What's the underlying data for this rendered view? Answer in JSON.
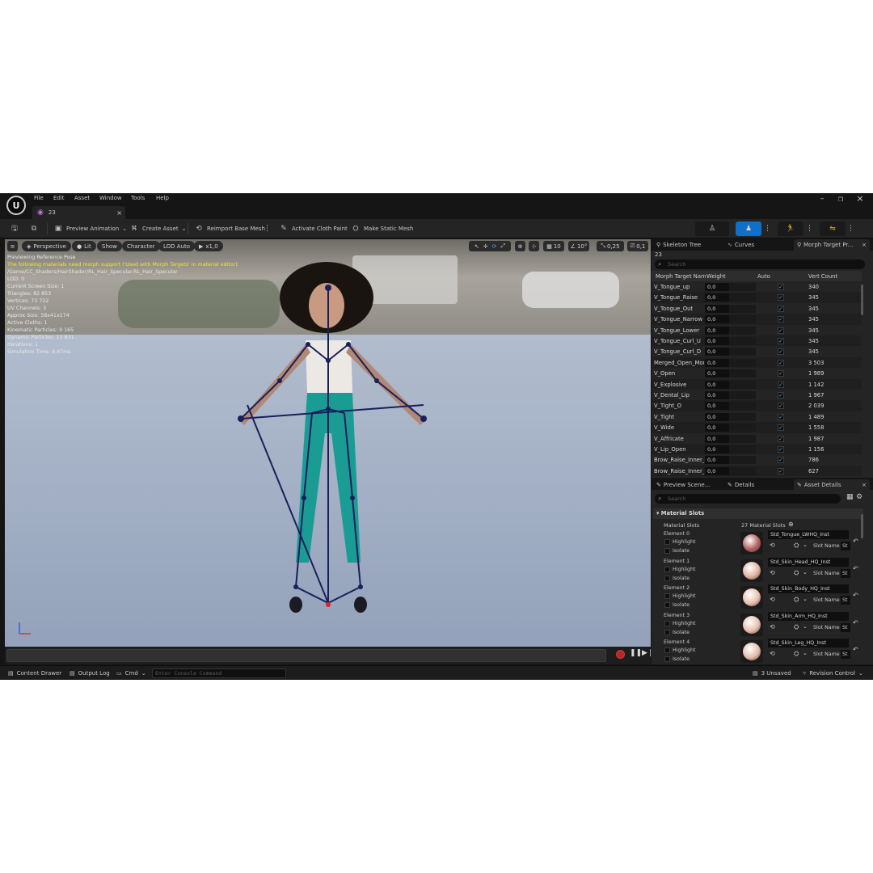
{
  "menu": [
    "File",
    "Edit",
    "Asset",
    "Window",
    "Tools",
    "Help"
  ],
  "asset_tab": "23",
  "toolbar": {
    "preview_animation": "Preview Animation",
    "create_asset": "Create Asset",
    "reimport": "Reimport Base Mesh",
    "activate_cloth": "Activate Cloth Paint",
    "make_static": "Make Static Mesh"
  },
  "viewport": {
    "perspective": "Perspective",
    "lit": "Lit",
    "show": "Show",
    "character": "Character",
    "lod": "LOD Auto",
    "speed": "x1,0",
    "grid_snap": "10",
    "rot_snap": "10°",
    "scale_snap": "0,25",
    "cam_speed": "0,1",
    "stats": [
      {
        "text": "Previewing Reference Pose",
        "warn": false
      },
      {
        "text": "The following materials need morph support ('Used with Morph Targets' in material editor):",
        "warn": true
      },
      {
        "text": "/Game/CC_Shaders/HairShader/RL_Hair_Specular.RL_Hair_Specular",
        "warn": false
      },
      {
        "text": "LOD: 0",
        "warn": false
      },
      {
        "text": "Current Screen Size: 1",
        "warn": false
      },
      {
        "text": "Triangles: 82 853",
        "warn": false
      },
      {
        "text": "Vertices: 73 722",
        "warn": false
      },
      {
        "text": "UV Channels: 3",
        "warn": false
      },
      {
        "text": "Approx Size: 58x41x174",
        "warn": false
      },
      {
        "text": "Active Cloths: 1",
        "warn": false
      },
      {
        "text": "Kinematic Particles: 9 165",
        "warn": false
      },
      {
        "text": "Dynamic Particles: 13 831",
        "warn": false
      },
      {
        "text": "Iterations: 1",
        "warn": false
      },
      {
        "text": "Simulation Time: 9,47ms",
        "warn": false
      }
    ]
  },
  "right_tabs": {
    "skeleton": "Skeleton Tree",
    "curves": "Curves",
    "morph": "Morph Target Pr..."
  },
  "morph": {
    "asset": "23",
    "search_placeholder": "Search",
    "columns": [
      "Morph Target Nam",
      "Weight",
      "Auto",
      "Vert Count"
    ],
    "rows": [
      {
        "name": "V_Tongue_up",
        "weight": "0,0",
        "count": "340"
      },
      {
        "name": "V_Tongue_Raise",
        "weight": "0,0",
        "count": "345"
      },
      {
        "name": "V_Tongue_Out",
        "weight": "0,0",
        "count": "345"
      },
      {
        "name": "V_Tongue_Narrow",
        "weight": "0,0",
        "count": "345"
      },
      {
        "name": "V_Tongue_Lower",
        "weight": "0,0",
        "count": "345"
      },
      {
        "name": "V_Tongue_Curl_U",
        "weight": "0,0",
        "count": "345"
      },
      {
        "name": "V_Tongue_Curl_D",
        "weight": "0,0",
        "count": "345"
      },
      {
        "name": "Merged_Open_Mout",
        "weight": "0,0",
        "count": "3 503"
      },
      {
        "name": "V_Open",
        "weight": "0,0",
        "count": "1 989"
      },
      {
        "name": "V_Explosive",
        "weight": "0,0",
        "count": "1 142"
      },
      {
        "name": "V_Dental_Lip",
        "weight": "0,0",
        "count": "1 967"
      },
      {
        "name": "V_Tight_O",
        "weight": "0,0",
        "count": "2 039"
      },
      {
        "name": "V_Tight",
        "weight": "0,0",
        "count": "1 489"
      },
      {
        "name": "V_Wide",
        "weight": "0,0",
        "count": "1 558"
      },
      {
        "name": "V_Affricate",
        "weight": "0,0",
        "count": "1 987"
      },
      {
        "name": "V_Lip_Open",
        "weight": "0,0",
        "count": "1 156"
      },
      {
        "name": "Brow_Raise_Inner_l",
        "weight": "0,0",
        "count": "786"
      },
      {
        "name": "Brow_Raise_Inner_l",
        "weight": "0,0",
        "count": "627"
      }
    ]
  },
  "details_tabs": {
    "preview_scene": "Preview Scene...",
    "details": "Details",
    "asset_details": "Asset Details"
  },
  "details": {
    "search_placeholder": "Search",
    "section": "Material Slots",
    "slots_label": "Material Slots",
    "slots_count": "27 Material Slots",
    "highlight": "Highlight",
    "isolate": "Isolate",
    "slot_name": "Slot Name",
    "slot_value": "St",
    "elements": [
      {
        "label": "Element 0",
        "material": "Std_Tongue_LWHQ_Inst",
        "color": "#b2605f"
      },
      {
        "label": "Element 1",
        "material": "Std_Skin_Head_HQ_Inst",
        "color": "#e2b3a2"
      },
      {
        "label": "Element 2",
        "material": "Std_Skin_Body_HQ_Inst",
        "color": "#e9c0b0"
      },
      {
        "label": "Element 3",
        "material": "Std_Skin_Arm_HQ_Inst",
        "color": "#e8bfb0"
      },
      {
        "label": "Element 4",
        "material": "Std_Skin_Leg_HQ_Inst",
        "color": "#e6bdae"
      }
    ]
  },
  "statusbar": {
    "content_drawer": "Content Drawer",
    "output_log": "Output Log",
    "cmd": "Cmd",
    "console_placeholder": "Enter Console Command",
    "unsaved": "3 Unsaved",
    "revision": "Revision Control"
  }
}
